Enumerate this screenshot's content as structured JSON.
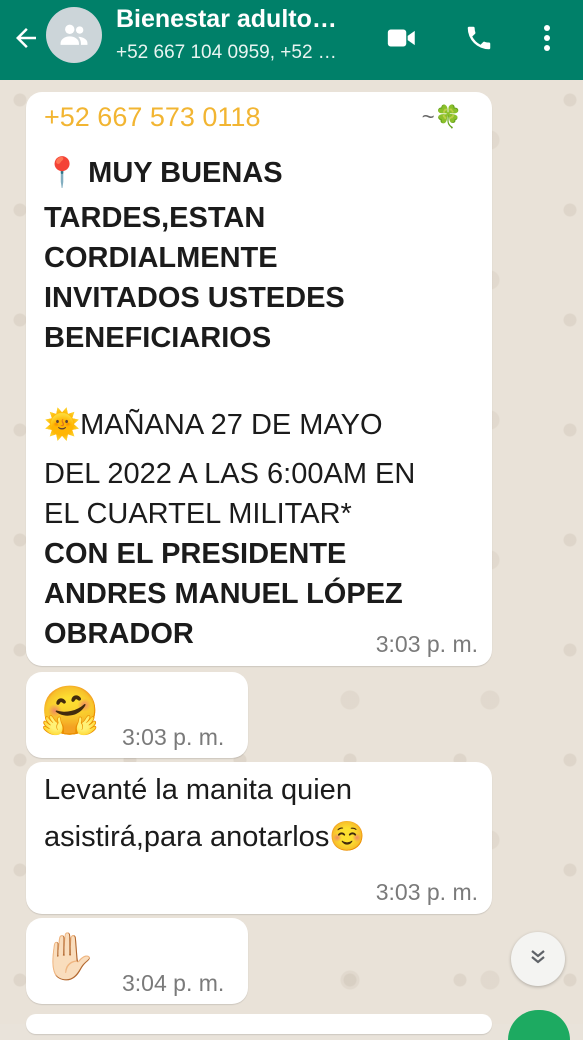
{
  "header": {
    "title": "Bienestar adulto…",
    "subtitle": "+52 667 104 0959, +52 …",
    "icons": [
      "back-arrow-icon",
      "group-avatar-icon",
      "video-call-icon",
      "phone-icon",
      "more-options-icon"
    ]
  },
  "messages": [
    {
      "sender": "+52 667 573 0118",
      "sender_suffix": "~🍀",
      "lines": [
        "📍 MUY BUENAS",
        "TARDES,ESTAN",
        "CORDIALMENTE",
        "INVITADOS USTEDES",
        "BENEFICIARIOS",
        "🌞MAÑANA 27 DE MAYO",
        "DEL 2022 A LAS 6:00AM EN",
        "EL CUARTEL MILITAR*",
        " CON EL PRESIDENTE",
        "ANDRES MANUEL LÓPEZ",
        "OBRADOR"
      ],
      "time": "3:03 p. m."
    },
    {
      "emoji": "🤗",
      "time": "3:03 p. m."
    },
    {
      "lines": [
        "Levanté la manita quien",
        "asistirá,para anotarlos☺️"
      ],
      "time": "3:03 p. m."
    },
    {
      "emoji": "✋🏻",
      "time": "3:04 p. m."
    }
  ],
  "colors": {
    "header": "#008069",
    "sender": "#f2b532",
    "chat_background": "#e9e2d8"
  }
}
